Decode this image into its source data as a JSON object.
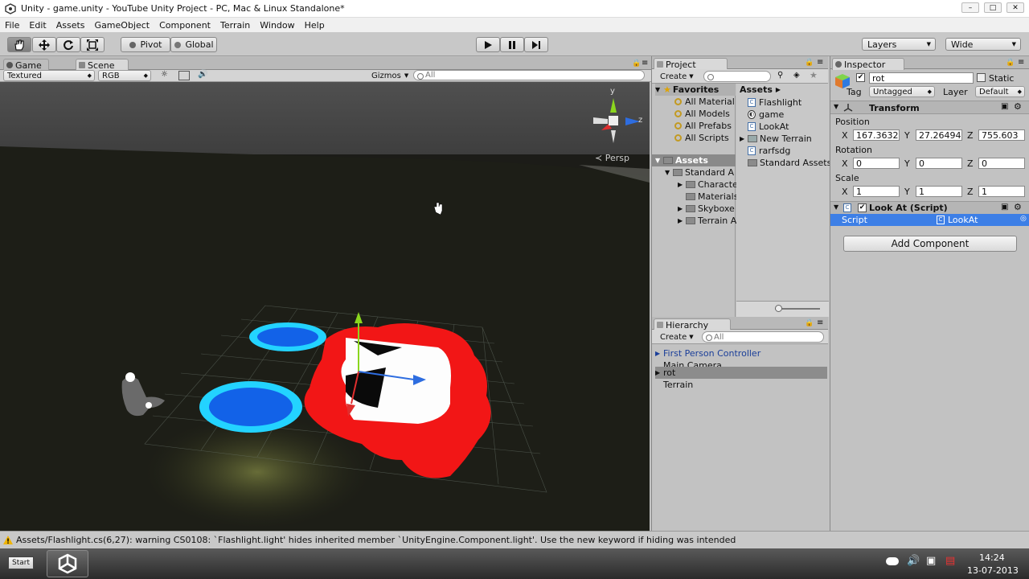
{
  "window": {
    "title": "Unity - game.unity - YouTube Unity Project - PC, Mac & Linux Standalone*",
    "controls": [
      "–",
      "□",
      "✕"
    ]
  },
  "menu": [
    "File",
    "Edit",
    "Assets",
    "GameObject",
    "Component",
    "Terrain",
    "Window",
    "Help"
  ],
  "toolbar": {
    "pivot_label": "Pivot",
    "global_label": "Global",
    "layers_label": "Layers",
    "layout_label": "Wide"
  },
  "scene_tabs": {
    "game": "Game",
    "scene": "Scene"
  },
  "scene_bar": {
    "render_mode": "Textured",
    "color_mode": "RGB",
    "gizmos_label": "Gizmos",
    "search_placeholder": "All"
  },
  "gizmo": {
    "y": "y",
    "z": "z",
    "persp": "Persp"
  },
  "project": {
    "tab_label": "Project",
    "create_label": "Create",
    "favorites_label": "Favorites",
    "favorites": [
      "All Material",
      "All Models",
      "All Prefabs",
      "All Scripts"
    ],
    "assets_label": "Assets",
    "asset_tree": [
      {
        "label": "Standard A",
        "depth": 1
      },
      {
        "label": "Characte",
        "depth": 2
      },
      {
        "label": "Materials",
        "depth": 2
      },
      {
        "label": "Skyboxe",
        "depth": 2
      },
      {
        "label": "Terrain A",
        "depth": 2
      }
    ],
    "breadcrumb": "Assets",
    "files": [
      {
        "label": "Flashlight",
        "icon": "script-icon"
      },
      {
        "label": "game",
        "icon": "unity-scene-icon"
      },
      {
        "label": "LookAt",
        "icon": "script-icon"
      },
      {
        "label": "New Terrain",
        "icon": "terrain-icon"
      },
      {
        "label": "rarfsdg",
        "icon": "script-icon"
      },
      {
        "label": "Standard Assets",
        "icon": "folder-icon"
      }
    ]
  },
  "hierarchy": {
    "tab_label": "Hierarchy",
    "create_label": "Create",
    "search_placeholder": "All",
    "items": [
      {
        "label": "First Person Controller",
        "expandable": true
      },
      {
        "label": "Main Camera",
        "expandable": false
      },
      {
        "label": "rot",
        "expandable": true
      },
      {
        "label": "Terrain",
        "expandable": false
      }
    ]
  },
  "inspector": {
    "tab_label": "Inspector",
    "object_name": "rot",
    "static_label": "Static",
    "tag_label": "Tag",
    "tag_value": "Untagged",
    "layer_label": "Layer",
    "layer_value": "Default",
    "transform_label": "Transform",
    "position_label": "Position",
    "rotation_label": "Rotation",
    "scale_label": "Scale",
    "axis": {
      "x": "X",
      "y": "Y",
      "z": "Z"
    },
    "position": {
      "x": "167.3632",
      "y": "27.26494",
      "z": "755.603"
    },
    "rotation": {
      "x": "0",
      "y": "0",
      "z": "0"
    },
    "scale": {
      "x": "1",
      "y": "1",
      "z": "1"
    },
    "script_component_label": "Look At (Script)",
    "script_field_label": "Script",
    "script_value": "LookAt",
    "add_component_label": "Add Component"
  },
  "status": {
    "message": "Assets/Flashlight.cs(6,27): warning CS0108: `Flashlight.light' hides inherited member `UnityEngine.Component.light'. Use the new keyword if hiding was intended"
  },
  "taskbar": {
    "start_label": "Start",
    "time": "14:24",
    "date": "13-07-2013"
  }
}
